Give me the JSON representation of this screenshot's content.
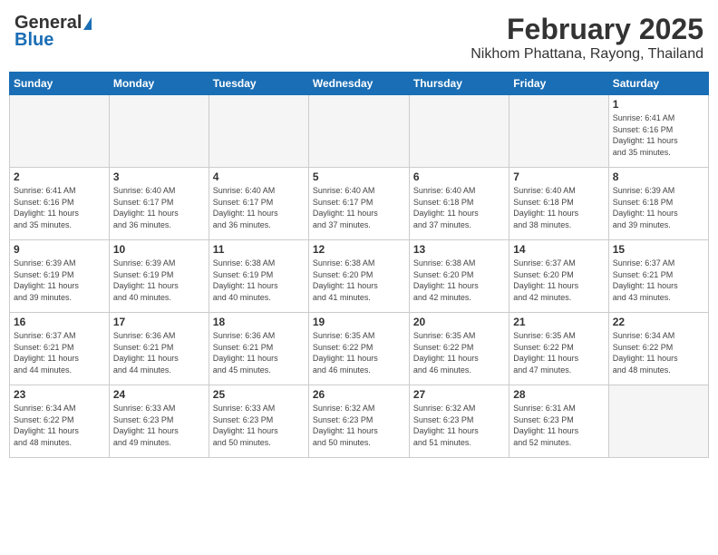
{
  "header": {
    "logo_general": "General",
    "logo_blue": "Blue",
    "month": "February 2025",
    "location": "Nikhom Phattana, Rayong, Thailand"
  },
  "weekdays": [
    "Sunday",
    "Monday",
    "Tuesday",
    "Wednesday",
    "Thursday",
    "Friday",
    "Saturday"
  ],
  "weeks": [
    [
      {
        "day": "",
        "info": ""
      },
      {
        "day": "",
        "info": ""
      },
      {
        "day": "",
        "info": ""
      },
      {
        "day": "",
        "info": ""
      },
      {
        "day": "",
        "info": ""
      },
      {
        "day": "",
        "info": ""
      },
      {
        "day": "1",
        "info": "Sunrise: 6:41 AM\nSunset: 6:16 PM\nDaylight: 11 hours\nand 35 minutes."
      }
    ],
    [
      {
        "day": "2",
        "info": "Sunrise: 6:41 AM\nSunset: 6:16 PM\nDaylight: 11 hours\nand 35 minutes."
      },
      {
        "day": "3",
        "info": "Sunrise: 6:40 AM\nSunset: 6:17 PM\nDaylight: 11 hours\nand 36 minutes."
      },
      {
        "day": "4",
        "info": "Sunrise: 6:40 AM\nSunset: 6:17 PM\nDaylight: 11 hours\nand 36 minutes."
      },
      {
        "day": "5",
        "info": "Sunrise: 6:40 AM\nSunset: 6:17 PM\nDaylight: 11 hours\nand 37 minutes."
      },
      {
        "day": "6",
        "info": "Sunrise: 6:40 AM\nSunset: 6:18 PM\nDaylight: 11 hours\nand 37 minutes."
      },
      {
        "day": "7",
        "info": "Sunrise: 6:40 AM\nSunset: 6:18 PM\nDaylight: 11 hours\nand 38 minutes."
      },
      {
        "day": "8",
        "info": "Sunrise: 6:39 AM\nSunset: 6:18 PM\nDaylight: 11 hours\nand 39 minutes."
      }
    ],
    [
      {
        "day": "9",
        "info": "Sunrise: 6:39 AM\nSunset: 6:19 PM\nDaylight: 11 hours\nand 39 minutes."
      },
      {
        "day": "10",
        "info": "Sunrise: 6:39 AM\nSunset: 6:19 PM\nDaylight: 11 hours\nand 40 minutes."
      },
      {
        "day": "11",
        "info": "Sunrise: 6:38 AM\nSunset: 6:19 PM\nDaylight: 11 hours\nand 40 minutes."
      },
      {
        "day": "12",
        "info": "Sunrise: 6:38 AM\nSunset: 6:20 PM\nDaylight: 11 hours\nand 41 minutes."
      },
      {
        "day": "13",
        "info": "Sunrise: 6:38 AM\nSunset: 6:20 PM\nDaylight: 11 hours\nand 42 minutes."
      },
      {
        "day": "14",
        "info": "Sunrise: 6:37 AM\nSunset: 6:20 PM\nDaylight: 11 hours\nand 42 minutes."
      },
      {
        "day": "15",
        "info": "Sunrise: 6:37 AM\nSunset: 6:21 PM\nDaylight: 11 hours\nand 43 minutes."
      }
    ],
    [
      {
        "day": "16",
        "info": "Sunrise: 6:37 AM\nSunset: 6:21 PM\nDaylight: 11 hours\nand 44 minutes."
      },
      {
        "day": "17",
        "info": "Sunrise: 6:36 AM\nSunset: 6:21 PM\nDaylight: 11 hours\nand 44 minutes."
      },
      {
        "day": "18",
        "info": "Sunrise: 6:36 AM\nSunset: 6:21 PM\nDaylight: 11 hours\nand 45 minutes."
      },
      {
        "day": "19",
        "info": "Sunrise: 6:35 AM\nSunset: 6:22 PM\nDaylight: 11 hours\nand 46 minutes."
      },
      {
        "day": "20",
        "info": "Sunrise: 6:35 AM\nSunset: 6:22 PM\nDaylight: 11 hours\nand 46 minutes."
      },
      {
        "day": "21",
        "info": "Sunrise: 6:35 AM\nSunset: 6:22 PM\nDaylight: 11 hours\nand 47 minutes."
      },
      {
        "day": "22",
        "info": "Sunrise: 6:34 AM\nSunset: 6:22 PM\nDaylight: 11 hours\nand 48 minutes."
      }
    ],
    [
      {
        "day": "23",
        "info": "Sunrise: 6:34 AM\nSunset: 6:22 PM\nDaylight: 11 hours\nand 48 minutes."
      },
      {
        "day": "24",
        "info": "Sunrise: 6:33 AM\nSunset: 6:23 PM\nDaylight: 11 hours\nand 49 minutes."
      },
      {
        "day": "25",
        "info": "Sunrise: 6:33 AM\nSunset: 6:23 PM\nDaylight: 11 hours\nand 50 minutes."
      },
      {
        "day": "26",
        "info": "Sunrise: 6:32 AM\nSunset: 6:23 PM\nDaylight: 11 hours\nand 50 minutes."
      },
      {
        "day": "27",
        "info": "Sunrise: 6:32 AM\nSunset: 6:23 PM\nDaylight: 11 hours\nand 51 minutes."
      },
      {
        "day": "28",
        "info": "Sunrise: 6:31 AM\nSunset: 6:23 PM\nDaylight: 11 hours\nand 52 minutes."
      },
      {
        "day": "",
        "info": ""
      }
    ]
  ]
}
